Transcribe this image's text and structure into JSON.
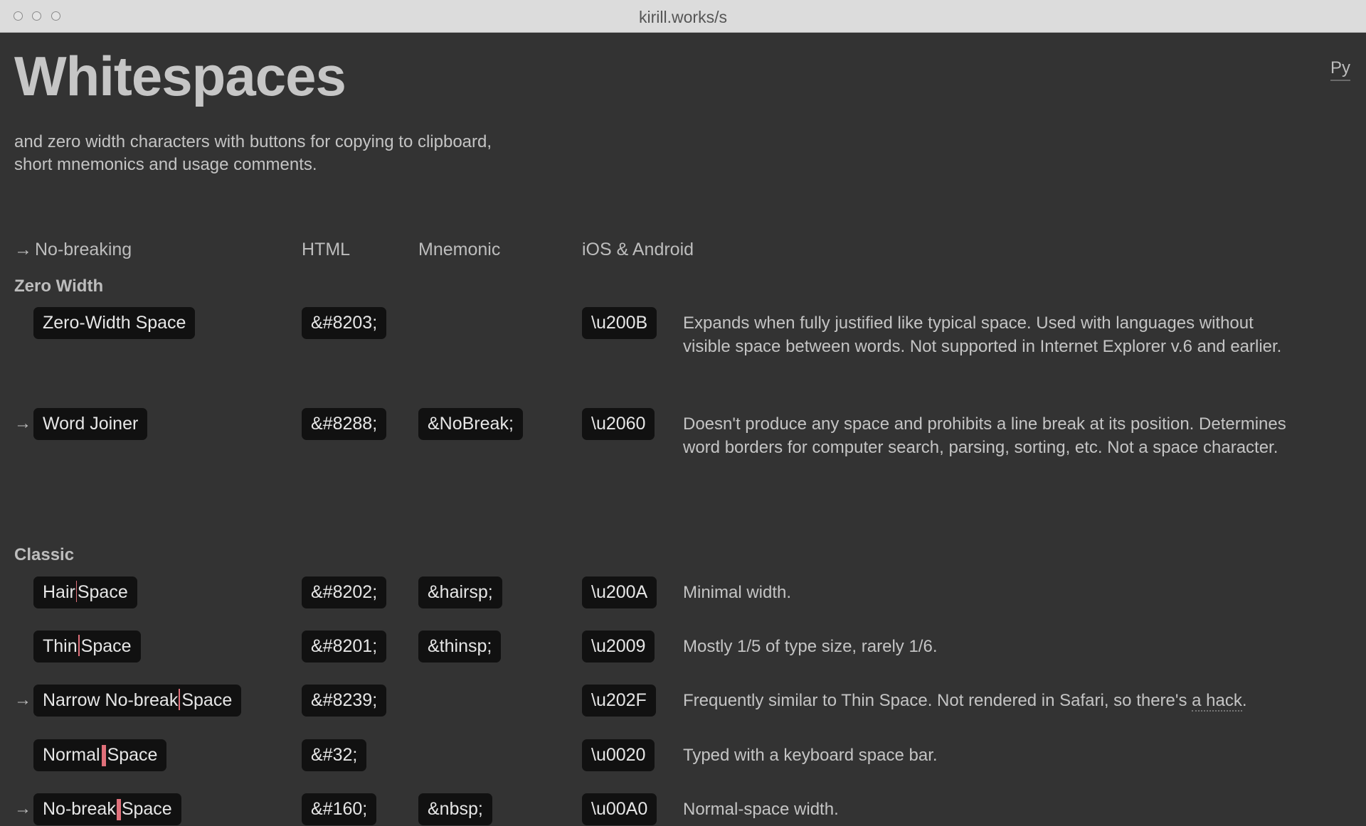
{
  "window": {
    "title": "kirill.works/s"
  },
  "page": {
    "title": "Whitespaces",
    "subtitle_line1": "and zero width characters with buttons for copying to clipboard,",
    "subtitle_line2": "short mnemonics and usage comments.",
    "lang_label": "Py"
  },
  "columns": {
    "arrow": "→",
    "no_breaking": "No-breaking",
    "html": "HTML",
    "mnemonic": "Mnemonic",
    "mobile": "iOS & Android"
  },
  "sections": {
    "zero_width": {
      "title": "Zero Width",
      "rows": [
        {
          "arrow": "",
          "name": "Zero-Width Space",
          "html": "&#8203;",
          "mnemonic": "",
          "code": "\\u200B",
          "desc": "Expands when fully justified like typical space. Used with languages without visible space between words. Not supported in Internet Explorer v.6 and earlier."
        },
        {
          "arrow": "→",
          "name": "Word Joiner",
          "html": "&#8288;",
          "mnemonic": "&NoBreak;",
          "code": "\\u2060",
          "desc": "Doesn't produce any space and prohibits a line break at its position. Determines word borders for computer search, parsing, sorting, etc. Not a space character."
        }
      ]
    },
    "classic": {
      "title": "Classic",
      "rows": [
        {
          "arrow": "",
          "name_a": "Hair",
          "name_b": "Space",
          "html": "&#8202;",
          "mnemonic": "&hairsp;",
          "code": "\\u200A",
          "desc": "Minimal width."
        },
        {
          "arrow": "",
          "name_a": "Thin",
          "name_b": "Space",
          "html": "&#8201;",
          "mnemonic": "&thinsp;",
          "code": "\\u2009",
          "desc": "Mostly 1/5 of type size, rarely 1/6."
        },
        {
          "arrow": "→",
          "name_a": "Narrow No-break",
          "name_b": "Space",
          "html": "&#8239;",
          "mnemonic": "",
          "code": "\\u202F",
          "desc": "Frequently similar to Thin Space. Not rendered in Safari, so there's ",
          "desc_link": "a hack",
          "desc_end": "."
        },
        {
          "arrow": "",
          "name_a": "Normal",
          "name_b": "Space",
          "html": "&#32;",
          "mnemonic": "",
          "code": "\\u0020",
          "desc": "Typed with a keyboard space bar."
        },
        {
          "arrow": "→",
          "name_a": "No-break",
          "name_b": "Space",
          "html": "&#160;",
          "mnemonic": "&nbsp;",
          "code": "\\u00A0",
          "desc": "Normal-space width."
        }
      ]
    }
  },
  "colors": {
    "background": "#333333",
    "chip": "#111111",
    "caret_accent": "#e0707a"
  }
}
